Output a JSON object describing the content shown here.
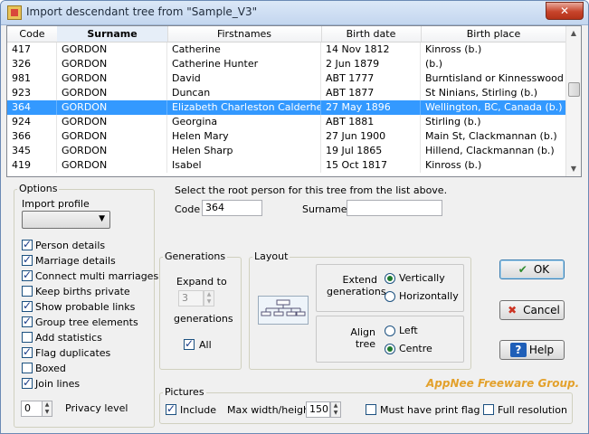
{
  "window": {
    "title": "Import descendant tree from \"Sample_V3\"",
    "close_label": "✕"
  },
  "list": {
    "columns": [
      "Code",
      "Surname",
      "Firstnames",
      "Birth date",
      "Birth place"
    ],
    "rows": [
      [
        "417",
        "GORDON",
        "Catherine",
        "14 Nov 1812",
        "Kinross (b.)"
      ],
      [
        "326",
        "GORDON",
        "Catherine Hunter",
        "2 Jun 1879",
        " (b.)"
      ],
      [
        "981",
        "GORDON",
        "David",
        "ABT 1777",
        "Burntisland or Kinnesswood (b.)"
      ],
      [
        "923",
        "GORDON",
        "Duncan",
        "ABT 1877",
        "St Ninians, Stirling (b.)"
      ],
      [
        "364",
        "GORDON",
        "Elizabeth Charleston Calderhead",
        "27 May 1896",
        "Wellington, BC, Canada (b.)"
      ],
      [
        "924",
        "GORDON",
        "Georgina",
        "ABT 1881",
        "Stirling (b.)"
      ],
      [
        "366",
        "GORDON",
        "Helen Mary",
        "27 Jun 1900",
        "Main St, Clackmannan (b.)"
      ],
      [
        "345",
        "GORDON",
        "Helen Sharp",
        "19 Jul 1865",
        "Hillend, Clackmannan (b.)"
      ],
      [
        "419",
        "GORDON",
        "Isabel",
        "15 Oct 1817",
        "Kinross (b.)"
      ]
    ],
    "selected_index": 4,
    "sorted_column": 1
  },
  "options": {
    "title": "Options",
    "import_profile_label": "Import profile",
    "import_profile_value": "",
    "checkboxes": [
      {
        "label": "Person details",
        "checked": true
      },
      {
        "label": "Marriage details",
        "checked": true
      },
      {
        "label": "Connect multi marriages",
        "checked": true
      },
      {
        "label": "Keep births private",
        "checked": false
      },
      {
        "label": "Show probable links",
        "checked": true
      },
      {
        "label": "Group tree elements",
        "checked": true
      },
      {
        "label": "Add statistics",
        "checked": false
      },
      {
        "label": "Flag duplicates",
        "checked": true
      },
      {
        "label": "Boxed",
        "checked": false
      },
      {
        "label": "Join lines",
        "checked": true
      }
    ],
    "privacy_value": "0",
    "privacy_label": "Privacy level"
  },
  "root": {
    "instruction": "Select the root person for this tree from the list above.",
    "code_label": "Code",
    "code_value": "364",
    "surname_label": "Surname",
    "surname_value": ""
  },
  "generations": {
    "title": "Generations",
    "expand_label": "Expand to",
    "expand_value": "3",
    "generations_label": "generations",
    "all_label": "All",
    "all_checked": true
  },
  "layout": {
    "title": "Layout",
    "extend_label": "Extend\ngenerations",
    "vertically": "Vertically",
    "horizontally": "Horizontally",
    "extend_choice": "vertically",
    "align_label": "Align\ntree",
    "left": "Left",
    "centre": "Centre",
    "align_choice": "centre"
  },
  "pictures": {
    "title": "Pictures",
    "include_label": "Include",
    "include_checked": true,
    "maxwh_label": "Max width/height",
    "maxwh_value": "150",
    "must_print_label": "Must have print flag",
    "must_print_checked": false,
    "full_res_label": "Full resolution",
    "full_res_checked": false
  },
  "buttons": {
    "ok": "OK",
    "cancel": "Cancel",
    "help": "Help"
  },
  "watermark": "AppNee Freeware Group.",
  "colors": {
    "selection": "#3399ff",
    "ok_icon": "#2e8b2e",
    "cancel_icon": "#cc3322",
    "help_icon": "#1f5fb8",
    "watermark": "#e3a12c"
  }
}
